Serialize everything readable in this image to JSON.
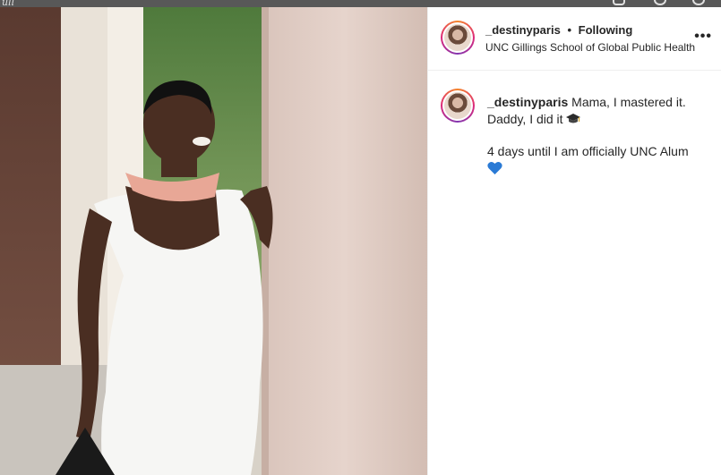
{
  "backdrop": {
    "fragment": "ull"
  },
  "post": {
    "author": {
      "username": "_destinyparis",
      "follow_status": "Following",
      "separator": "•",
      "location": "UNC Gillings School of Global Public Health"
    },
    "more_label": "•••",
    "caption": {
      "username": "_destinyparis",
      "line1": "Mama, I mastered it.",
      "line2": "Daddy, I did it",
      "line3": "4 days until I am officially UNC Alum"
    }
  },
  "colors": {
    "heart": "#2a7ad5",
    "story_ring_start": "#f58529",
    "story_ring_end": "#8134af"
  }
}
